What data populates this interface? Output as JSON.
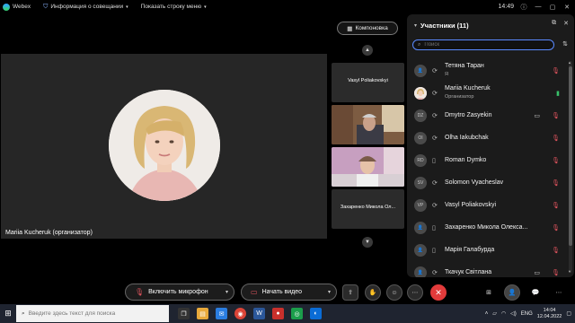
{
  "app": {
    "name": "Webex",
    "meeting_info": "Информация о совещании",
    "show_menu": "Показать строку меню",
    "time": "14:49"
  },
  "layout_button": "Компоновка",
  "main_video": {
    "name": "Mariia Kucheruk (организатор)"
  },
  "side_tiles": [
    {
      "name": "Vasyl Poliakovskyi"
    },
    {
      "name": ""
    },
    {
      "name": ""
    },
    {
      "name": "Захаренко Микола Ол..."
    }
  ],
  "panel": {
    "title": "Участники (11)",
    "search_placeholder": "Поиск",
    "participants": [
      {
        "initials": "",
        "name": "Тетяна Таран",
        "sub": "Я",
        "mic": "muted",
        "camera": false
      },
      {
        "initials": "",
        "name": "Mariia Kucheruk",
        "sub": "Организатор",
        "mic": "on",
        "camera": false,
        "photo": true
      },
      {
        "initials": "DZ",
        "name": "Dmytro Zasyekin",
        "sub": "",
        "mic": "muted",
        "camera": true
      },
      {
        "initials": "OI",
        "name": "Olha Iakubchak",
        "sub": "",
        "mic": "muted",
        "camera": false
      },
      {
        "initials": "RD",
        "name": "Roman Dymko",
        "sub": "",
        "mic": "muted",
        "camera": false
      },
      {
        "initials": "SV",
        "name": "Solomon Vyacheslav",
        "sub": "",
        "mic": "muted",
        "camera": false
      },
      {
        "initials": "VP",
        "name": "Vasyl Poliakovskyi",
        "sub": "",
        "mic": "muted",
        "camera": false
      },
      {
        "initials": "",
        "name": "Захаренко Микола Олекса...",
        "sub": "",
        "mic": "muted",
        "camera": true
      },
      {
        "initials": "",
        "name": "Марія Галабурда",
        "sub": "",
        "mic": "muted",
        "camera": false
      },
      {
        "initials": "",
        "name": "Ткачук Світлана",
        "sub": "",
        "mic": "muted",
        "camera": true
      }
    ]
  },
  "controls": {
    "mic_label": "Включить микрофон",
    "video_label": "Начать видео"
  },
  "taskbar": {
    "search_placeholder": "Введите здесь текст для поиска",
    "lang": "ENG",
    "time": "14:04",
    "date": "12.04.2022"
  },
  "colors": {
    "muted_red": "#e0545e",
    "end_call": "#e23b3b",
    "search_border": "#5a8aff"
  }
}
